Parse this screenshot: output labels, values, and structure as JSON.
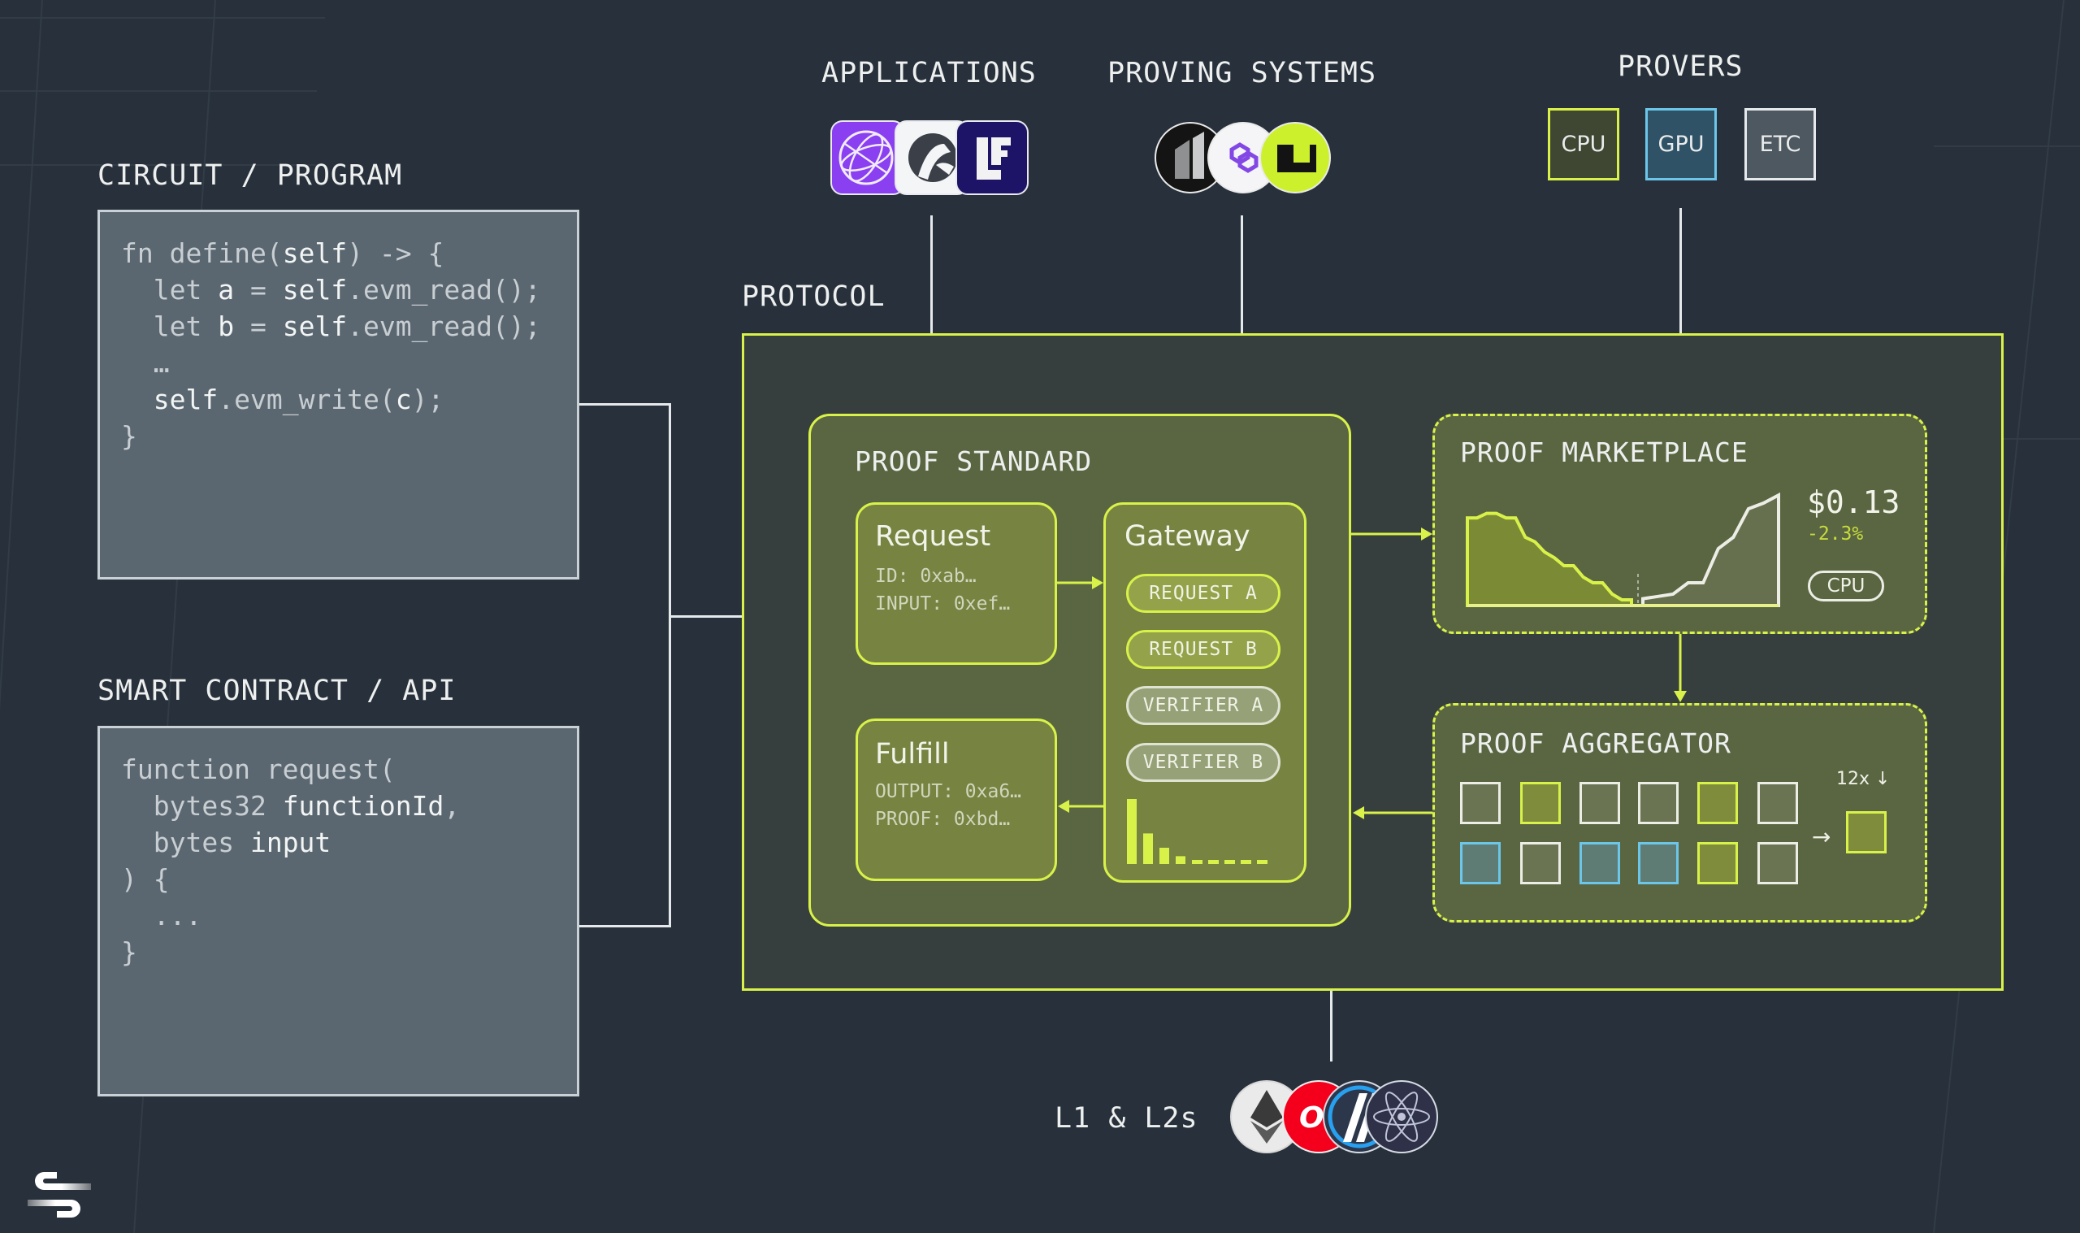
{
  "left": {
    "circuit": {
      "label": "CIRCUIT / PROGRAM",
      "code": [
        [
          {
            "t": "fn define(",
            "h": false
          },
          {
            "t": "self",
            "h": true
          },
          {
            "t": ") -> {",
            "h": false
          }
        ],
        [
          {
            "t": "  let ",
            "h": false
          },
          {
            "t": "a",
            "h": true
          },
          {
            "t": " = ",
            "h": false
          },
          {
            "t": "self",
            "h": true
          },
          {
            "t": ".evm_read();",
            "h": false
          }
        ],
        [
          {
            "t": "  let ",
            "h": false
          },
          {
            "t": "b",
            "h": true
          },
          {
            "t": " = ",
            "h": false
          },
          {
            "t": "self",
            "h": true
          },
          {
            "t": ".evm_read();",
            "h": false
          }
        ],
        [
          {
            "t": "  …",
            "h": false
          }
        ],
        [
          {
            "t": "  ",
            "h": false
          },
          {
            "t": "self",
            "h": true
          },
          {
            "t": ".evm_write(",
            "h": false
          },
          {
            "t": "c",
            "h": true
          },
          {
            "t": ");",
            "h": false
          }
        ],
        [
          {
            "t": "}",
            "h": false
          }
        ]
      ]
    },
    "contract": {
      "label": "SMART CONTRACT / API",
      "code": [
        [
          {
            "t": "function request(",
            "h": false
          }
        ],
        [
          {
            "t": "  bytes32 ",
            "h": false
          },
          {
            "t": "functionId",
            "h": true
          },
          {
            "t": ",",
            "h": false
          }
        ],
        [
          {
            "t": "  bytes ",
            "h": false
          },
          {
            "t": "input",
            "h": true
          }
        ],
        [
          {
            "t": ") {",
            "h": false
          }
        ],
        [
          {
            "t": "  ...",
            "h": false
          }
        ],
        [
          {
            "t": "}",
            "h": false
          }
        ]
      ]
    }
  },
  "top": {
    "applications": {
      "label": "APPLICATIONS",
      "logos": [
        "globe-app-logo",
        "arc-app-logo",
        "lf-app-logo"
      ]
    },
    "proving_systems": {
      "label": "PROVING SYSTEMS",
      "logos": [
        "pillar-logo",
        "polygon-logo",
        "lime-logo"
      ]
    },
    "provers": {
      "label": "PROVERS",
      "items": [
        {
          "label": "CPU",
          "border": "#d9f24a",
          "fill": "#3f4732"
        },
        {
          "label": "GPU",
          "border": "#6cc6ea",
          "fill": "#2f5266"
        },
        {
          "label": "ETC",
          "border": "#e6e9ec",
          "fill": "#4e5860"
        }
      ]
    }
  },
  "protocol": {
    "label": "PROTOCOL",
    "proof_standard": {
      "label": "PROOF STANDARD",
      "request": {
        "title": "Request",
        "lines": [
          "ID: 0xab…",
          "INPUT: 0xef…"
        ]
      },
      "fulfill": {
        "title": "Fulfill",
        "lines": [
          "OUTPUT: 0xa6…",
          "PROOF: 0xbd…"
        ]
      },
      "gateway": {
        "title": "Gateway",
        "requests": [
          "REQUEST A",
          "REQUEST B"
        ],
        "verifiers": [
          "VERIFIER A",
          "VERIFIER B"
        ],
        "bars": [
          1.0,
          0.47,
          0.25,
          0.12,
          0.06,
          0.06,
          0.06,
          0.06,
          0.06
        ]
      }
    },
    "marketplace": {
      "label": "PROOF MARKETPLACE",
      "price": "$0.13",
      "change": "-2.3%",
      "badge": "CPU",
      "left_series": [
        0.77,
        0.77,
        0.81,
        0.81,
        0.77,
        0.77,
        0.6,
        0.56,
        0.47,
        0.42,
        0.35,
        0.35,
        0.25,
        0.2,
        0.2,
        0.1,
        0.05,
        0.05
      ],
      "right_series": [
        0.06,
        0.08,
        0.1,
        0.2,
        0.2,
        0.5,
        0.6,
        0.85,
        0.9,
        0.97
      ]
    },
    "aggregator": {
      "label": "PROOF AGGREGATOR",
      "factor": "12x",
      "rows": [
        [
          "white",
          "yellow",
          "white",
          "white",
          "yellow",
          "white"
        ],
        [
          "blue",
          "white",
          "blue",
          "blue",
          "yellow",
          "white"
        ]
      ],
      "output": "yellow"
    }
  },
  "bottom": {
    "label": "L1 & L2s",
    "logos": [
      "ethereum-logo",
      "optimism-logo",
      "arbitrum-logo",
      "cosmos-logo"
    ]
  },
  "brand": {
    "logo": "succinct-logo"
  },
  "colors": {
    "accent": "#d9f24a",
    "blue": "#6cc6ea",
    "bg": "#28313b"
  }
}
